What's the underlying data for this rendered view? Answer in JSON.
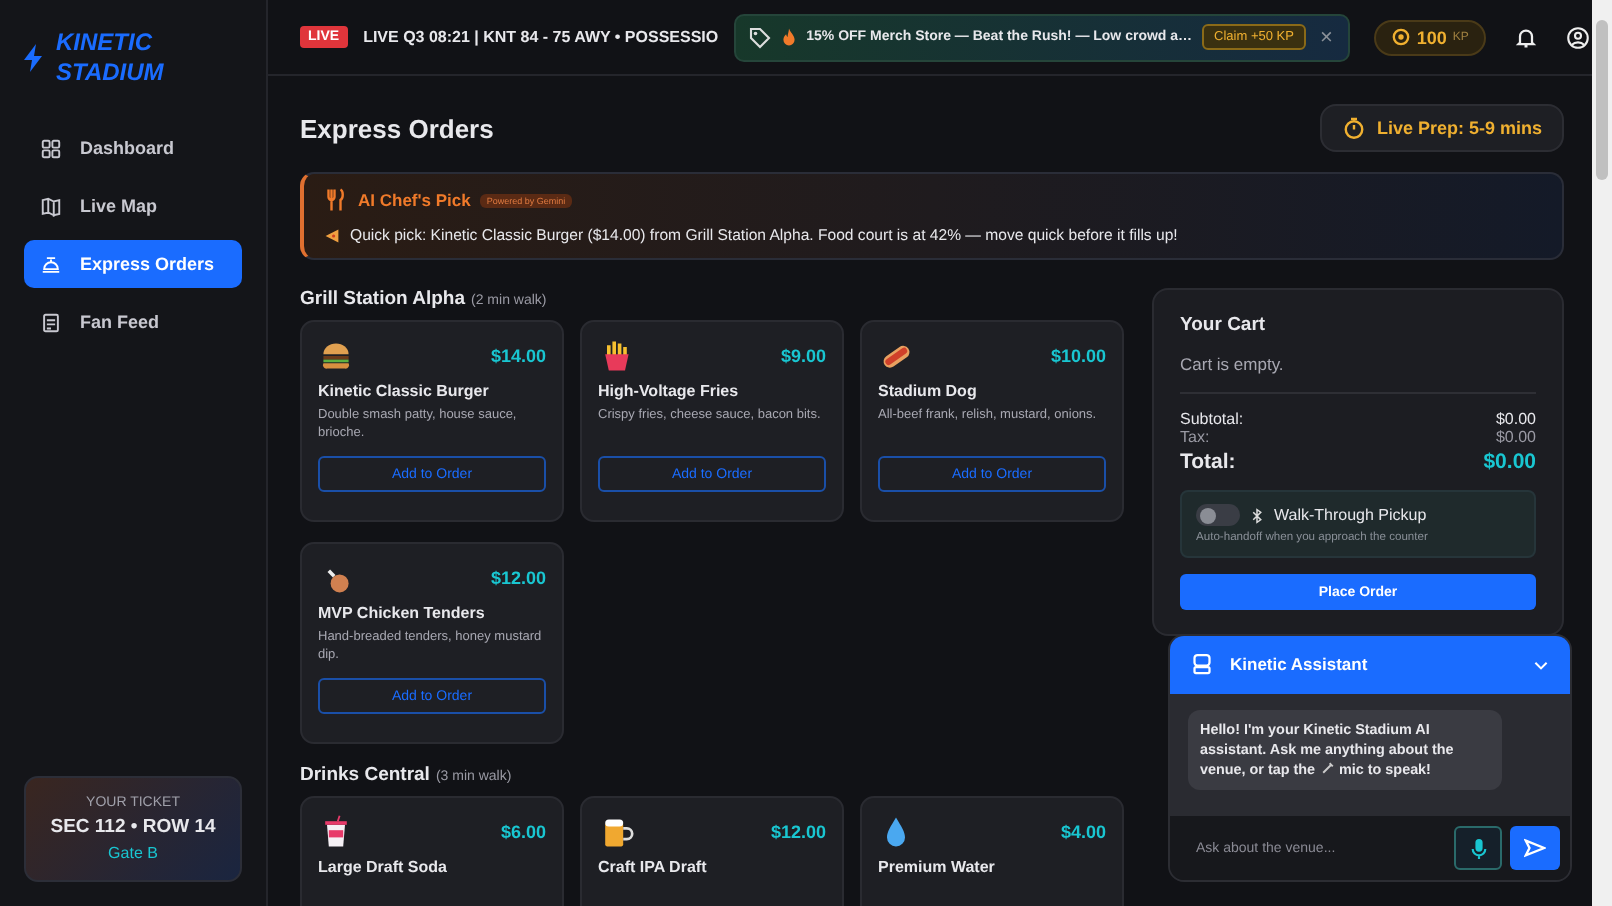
{
  "brand": {
    "name": "KINETIC STADIUM"
  },
  "sidebar": {
    "items": [
      {
        "label": "Dashboard",
        "selected": false
      },
      {
        "label": "Live Map",
        "selected": false
      },
      {
        "label": "Express Orders",
        "selected": true
      },
      {
        "label": "Fan Feed",
        "selected": false
      }
    ],
    "ticket": {
      "heading": "YOUR TICKET",
      "seat": "SEC 112 • ROW 14",
      "gate": "Gate B"
    }
  },
  "topbar": {
    "live_badge": "LIVE",
    "ticker": "LIVE Q3 08:21 | KNT 84 - 75 AWY • POSSESSIO",
    "promo": {
      "text": "15% OFF Merch Store — Beat the Rush! — Low crowd a…",
      "claim": "Claim +50 KP",
      "close": "×"
    },
    "points": "100",
    "points_unit": "KP"
  },
  "page": {
    "title": "Express Orders",
    "prep": "Live Prep: 5-9 mins"
  },
  "chef_pick": {
    "title": "AI Chef's Pick",
    "badge": "Powered by Gemini",
    "message": "Quick pick: Kinetic Classic Burger ($14.00) from Grill Station Alpha. Food court is at 42% — move quick before it fills up!"
  },
  "sections": [
    {
      "name": "Grill Station Alpha",
      "walk": "(2 min walk)",
      "items": [
        {
          "name": "Kinetic Classic Burger",
          "price": "$14.00",
          "description": "Double smash patty, house sauce, brioche.",
          "button": "Add to Order"
        },
        {
          "name": "High-Voltage Fries",
          "price": "$9.00",
          "description": "Crispy fries, cheese sauce, bacon bits.",
          "button": "Add to Order"
        },
        {
          "name": "Stadium Dog",
          "price": "$10.00",
          "description": "All-beef frank, relish, mustard, onions.",
          "button": "Add to Order"
        },
        {
          "name": "MVP Chicken Tenders",
          "price": "$12.00",
          "description": "Hand-breaded tenders, honey mustard dip.",
          "button": "Add to Order"
        }
      ]
    },
    {
      "name": "Drinks Central",
      "walk": "(3 min walk)",
      "items": [
        {
          "name": "Large Draft Soda",
          "price": "$6.00"
        },
        {
          "name": "Craft IPA Draft",
          "price": "$12.00"
        },
        {
          "name": "Premium Water",
          "price": "$4.00"
        }
      ]
    }
  ],
  "cart": {
    "title": "Your Cart",
    "empty": "Cart is empty.",
    "subtotal_label": "Subtotal:",
    "subtotal": "$0.00",
    "tax_label": "Tax:",
    "tax": "$0.00",
    "total_label": "Total:",
    "total": "$0.00",
    "pickup": {
      "label": "Walk-Through Pickup",
      "hint": "Auto-handoff when you approach the counter",
      "on": false
    },
    "button": "Place Order"
  },
  "assistant": {
    "title": "Kinetic Assistant",
    "message": "Hello! I'm your Kinetic Stadium AI assistant. Ask me anything about the venue, or tap the",
    "message_end": "mic to speak!",
    "placeholder": "Ask about the venue..."
  }
}
